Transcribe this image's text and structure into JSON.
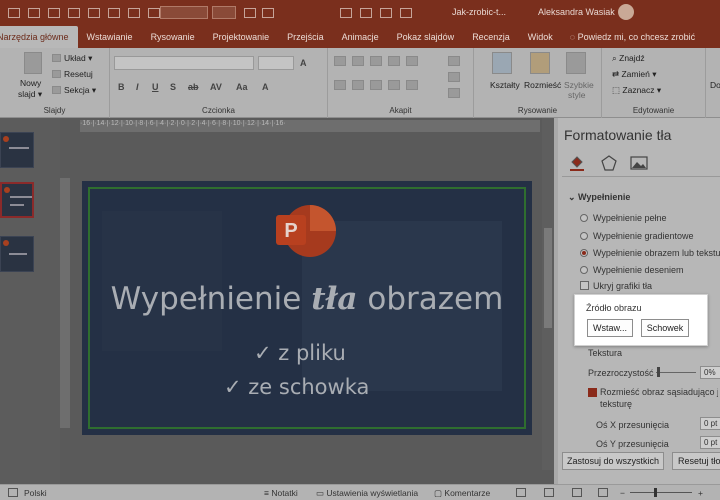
{
  "titlebar": {
    "document": "Jak-zrobic-t...",
    "user": "Aleksandra Wasiak"
  },
  "tabs": [
    {
      "label": "Narzędzia główne",
      "active": true
    },
    {
      "label": "Wstawianie"
    },
    {
      "label": "Rysowanie"
    },
    {
      "label": "Projektowanie"
    },
    {
      "label": "Przejścia"
    },
    {
      "label": "Animacje"
    },
    {
      "label": "Pokaz slajdów"
    },
    {
      "label": "Recenzja"
    },
    {
      "label": "Widok"
    }
  ],
  "tell_me": "Powiedz mi, co chcesz zrobić",
  "ribbon": {
    "slides": {
      "new_slide_1": "Nowy",
      "new_slide_2": "slajd ▾",
      "layout": "Układ ▾",
      "reset": "Resetuj",
      "section": "Sekcja ▾",
      "label": "Slajdy"
    },
    "font": {
      "label": "Czcionka"
    },
    "paragraph": {
      "label": "Akapit"
    },
    "drawing": {
      "shapes": "Kształty",
      "arrange": "Rozmieść",
      "styles_1": "Szybkie",
      "styles_2": "style",
      "label": "Rysowanie"
    },
    "editing": {
      "find": "Znajdź",
      "replace": "Zamień ▾",
      "select": "Zaznacz ▾",
      "label": "Edytowanie"
    },
    "extra": "Do"
  },
  "slide": {
    "title_before": "Wypełnienie ",
    "title_italic": "tła",
    "title_after": " obrazem",
    "bullet1": "✓ z pliku",
    "bullet2": "✓ ze schowka"
  },
  "ruler_text": "·16·|·14·|·12·|·10·|·8·|·6·|·4·|·2·|·0·|·2·|·4·|·6·|·8·|·10·|·12·|·14·|·16·",
  "pane": {
    "title": "Formatowanie tła",
    "section": "Wypełnienie",
    "options": [
      {
        "label": "Wypełnienie pełne",
        "checked": false
      },
      {
        "label": "Wypełnienie gradientowe",
        "checked": false
      },
      {
        "label": "Wypełnienie obrazem lub teksturą",
        "checked": true
      },
      {
        "label": "Wypełnienie deseniem",
        "checked": false
      }
    ],
    "hide_graphics": "Ukryj grafiki tła",
    "texture": "Tekstura",
    "transparency": "Przezroczystość",
    "transparency_value": "0%",
    "tile_1": "Rozmieść obraz sąsiadująco jako",
    "tile_2": "teksturę",
    "offset_x": "Oś X przesunięcia",
    "offset_x_value": "0 pt",
    "offset_y": "Oś Y przesunięcia",
    "offset_y_value": "0 pt",
    "apply_all": "Zastosuj do wszystkich",
    "reset_bg": "Resetuj tło"
  },
  "popup": {
    "title": "Źródło obrazu",
    "insert": "Wstaw...",
    "clipboard": "Schowek"
  },
  "status": {
    "language": "Polski",
    "notes": "Notatki",
    "display": "Ustawienia wyświetlania",
    "comments": "Komentarze"
  },
  "colors": {
    "accent": "#7a2f1d",
    "slide_bg": "#243045",
    "frame": "#2f6e2f",
    "logo": "#c43e1c"
  }
}
